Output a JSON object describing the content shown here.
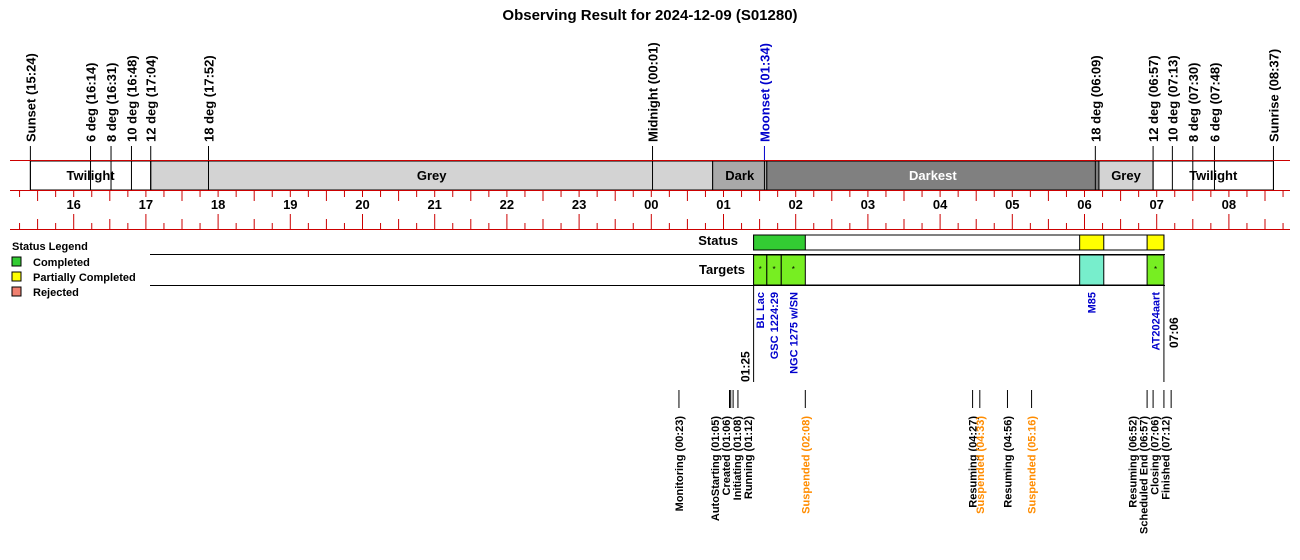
{
  "title": "Observing Result for 2024-12-09 (S01280)",
  "chart_data": {
    "type": "timeline",
    "x_axis": {
      "unit": "hours",
      "range": [
        15.4,
        32.62
      ],
      "tick_labels": [
        "16",
        "17",
        "18",
        "19",
        "20",
        "21",
        "22",
        "23",
        "00",
        "01",
        "02",
        "03",
        "04",
        "05",
        "06",
        "07",
        "08"
      ],
      "tick_values": [
        16,
        17,
        18,
        19,
        20,
        21,
        22,
        23,
        24,
        25,
        26,
        27,
        28,
        29,
        30,
        31,
        32
      ]
    },
    "top_events": [
      {
        "label": "Sunset (15:24)",
        "t": 15.4,
        "color": "#000000"
      },
      {
        "label": "6 deg (16:14)",
        "t": 16.233,
        "color": "#000000"
      },
      {
        "label": "8 deg (16:31)",
        "t": 16.517,
        "color": "#000000"
      },
      {
        "label": "10 deg (16:48)",
        "t": 16.8,
        "color": "#000000"
      },
      {
        "label": "12 deg (17:04)",
        "t": 17.067,
        "color": "#000000"
      },
      {
        "label": "18 deg (17:52)",
        "t": 17.867,
        "color": "#000000"
      },
      {
        "label": "Midnight (00:01)",
        "t": 24.017,
        "color": "#000000"
      },
      {
        "label": "Moonset (01:34)",
        "t": 25.567,
        "color": "#0000cc"
      },
      {
        "label": "18 deg (06:09)",
        "t": 30.15,
        "color": "#000000"
      },
      {
        "label": "12 deg (06:57)",
        "t": 30.95,
        "color": "#000000"
      },
      {
        "label": "10 deg (07:13)",
        "t": 31.217,
        "color": "#000000"
      },
      {
        "label": "8 deg (07:30)",
        "t": 31.5,
        "color": "#000000"
      },
      {
        "label": "6 deg (07:48)",
        "t": 31.8,
        "color": "#000000"
      },
      {
        "label": "Sunrise (08:37)",
        "t": 32.617,
        "color": "#000000"
      }
    ],
    "sky_bands": [
      {
        "label": "Twilight",
        "start": 15.4,
        "end": 17.067,
        "color": "#ffffff"
      },
      {
        "label": "Grey",
        "start": 17.067,
        "end": 24.85,
        "color": "#d3d3d3"
      },
      {
        "label": "Dark",
        "start": 24.85,
        "end": 25.6,
        "color": "#a9a9a9"
      },
      {
        "label": "Darkest",
        "start": 25.6,
        "end": 30.2,
        "color": "#808080"
      },
      {
        "label": "Grey",
        "start": 30.2,
        "end": 30.95,
        "color": "#d3d3d3"
      },
      {
        "label": "Twilight",
        "start": 30.95,
        "end": 32.617,
        "color": "#ffffff"
      }
    ],
    "rows": {
      "status_label": "Status",
      "targets_label": "Targets"
    },
    "legend": {
      "title": "Status Legend",
      "items": [
        {
          "label": "Completed",
          "color": "#33cc33"
        },
        {
          "label": "Partially Completed",
          "color": "#ffff00"
        },
        {
          "label": "Rejected",
          "color": "#f08070"
        }
      ]
    },
    "status_bar": {
      "start": 25.417,
      "end": 31.1,
      "segments": [
        {
          "start": 25.417,
          "end": 26.133,
          "status": "Completed",
          "color": "#33cc33"
        },
        {
          "start": 29.933,
          "end": 30.267,
          "status": "Partially Completed",
          "color": "#ffff00"
        },
        {
          "start": 30.867,
          "end": 31.1,
          "status": "Partially Completed",
          "color": "#ffff00"
        }
      ]
    },
    "targets": [
      {
        "name": "BL Lac",
        "start": 25.417,
        "end": 25.6,
        "color": "#77ee22",
        "mark": "*"
      },
      {
        "name": "GSC 1224:29",
        "start": 25.6,
        "end": 25.8,
        "color": "#77ee22",
        "mark": "*"
      },
      {
        "name": "NGC 1275 w/SN",
        "start": 25.8,
        "end": 26.133,
        "color": "#77ee22",
        "mark": "*"
      },
      {
        "name": "M85",
        "start": 29.933,
        "end": 30.267,
        "color": "#77eecc",
        "mark": ""
      },
      {
        "name": "AT2024aart",
        "start": 30.867,
        "end": 31.1,
        "color": "#77ee22",
        "mark": "*"
      }
    ],
    "time_marks": [
      {
        "label": "01:25",
        "t": 25.417
      },
      {
        "label": "07:06",
        "t": 31.1
      }
    ],
    "bottom_events": [
      {
        "label": "Monitoring (00:23)",
        "t": 24.383,
        "color": "#000000"
      },
      {
        "label": "AutoStarting (01:05)",
        "t": 25.083,
        "color": "#000000"
      },
      {
        "label": "Created (01:06)",
        "t": 25.1,
        "color": "#000000"
      },
      {
        "label": "Initiating (01:08)",
        "t": 25.133,
        "color": "#000000"
      },
      {
        "label": "Running (01:12)",
        "t": 25.2,
        "color": "#000000"
      },
      {
        "label": "Suspended (02:08)",
        "t": 26.133,
        "color": "#ff8c00"
      },
      {
        "label": "Resuming (04:27)",
        "t": 28.45,
        "color": "#000000"
      },
      {
        "label": "Suspended (04:33)",
        "t": 28.55,
        "color": "#ff8c00"
      },
      {
        "label": "Resuming (04:56)",
        "t": 28.933,
        "color": "#000000"
      },
      {
        "label": "Suspended (05:16)",
        "t": 29.267,
        "color": "#ff8c00"
      },
      {
        "label": "Resuming (06:52)",
        "t": 30.867,
        "color": "#000000"
      },
      {
        "label": "Scheduled End (06:57)",
        "t": 30.95,
        "color": "#000000"
      },
      {
        "label": "Closing (07:06)",
        "t": 31.1,
        "color": "#000000"
      },
      {
        "label": "Finished (07:12)",
        "t": 31.2,
        "color": "#000000"
      }
    ]
  }
}
